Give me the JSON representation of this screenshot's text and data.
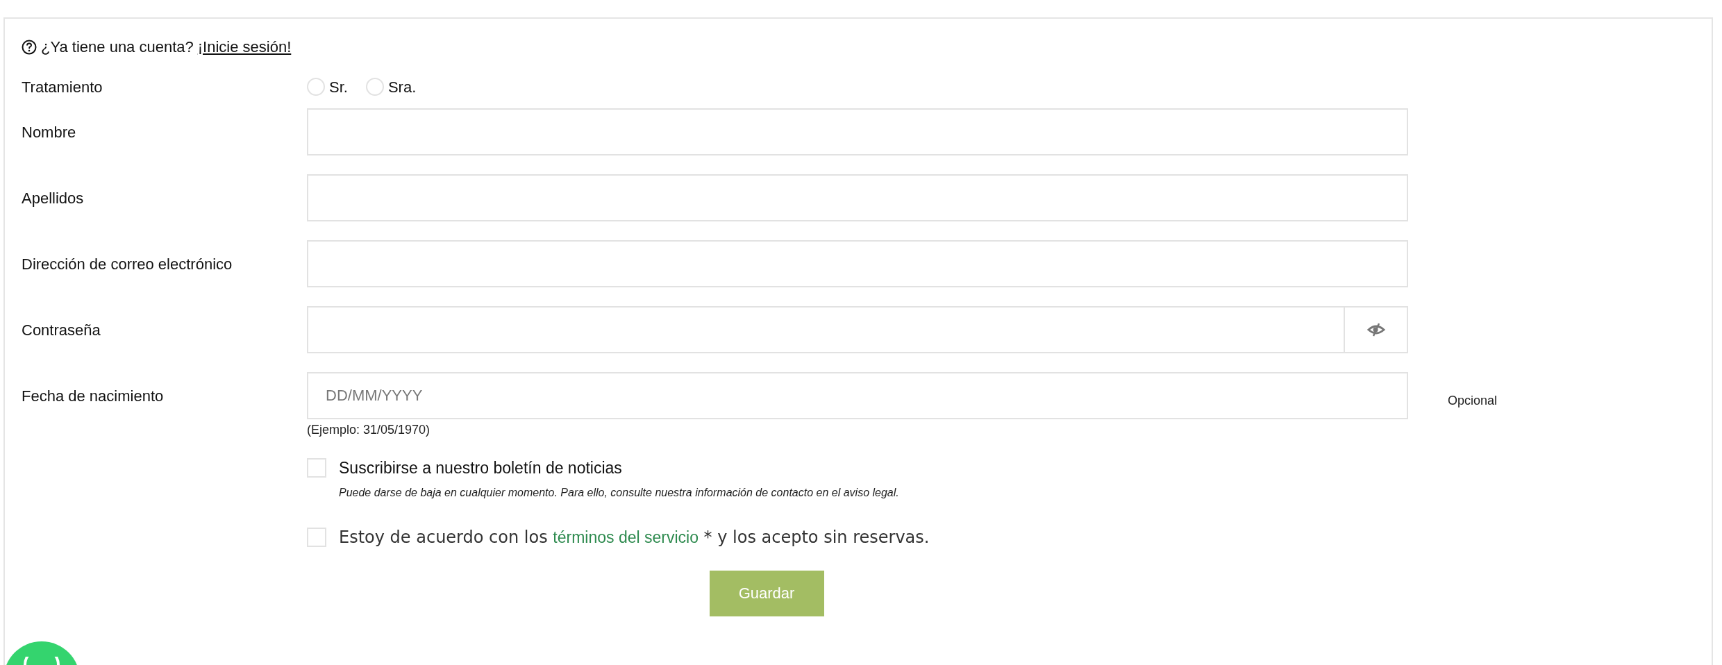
{
  "login_prompt": {
    "text": "¿Ya tiene una cuenta?",
    "link": "¡Inicie sesión!"
  },
  "fields": [
    {
      "kind": "radio",
      "label": "Tratamiento",
      "options": [
        {
          "label": "Sr.",
          "selected": false
        },
        {
          "label": "Sra.",
          "selected": false
        }
      ]
    },
    {
      "kind": "text",
      "label": "Nombre"
    },
    {
      "kind": "text",
      "label": "Apellidos"
    },
    {
      "kind": "text",
      "label": "Dirección de correo electrónico"
    },
    {
      "kind": "password",
      "label": "Contraseña"
    },
    {
      "kind": "date",
      "label": "Fecha de nacimiento",
      "placeholder": "DD/MM/YYYY",
      "hint": "(Ejemplo: 31/05/1970)",
      "note": "Opcional"
    }
  ],
  "checkboxes": [
    {
      "kind": "newsletter",
      "label": "Suscribirse a nuestro boletín de noticias",
      "checked": false,
      "help": "Puede darse de baja en cualquier momento. Para ello, consulte nuestra información de contacto en el aviso legal."
    },
    {
      "kind": "terms",
      "before": "Estoy de acuerdo con los",
      "link": "términos del servicio",
      "after": "* y los acepto sin reservas.",
      "checked": false
    }
  ],
  "submit": "Guardar"
}
